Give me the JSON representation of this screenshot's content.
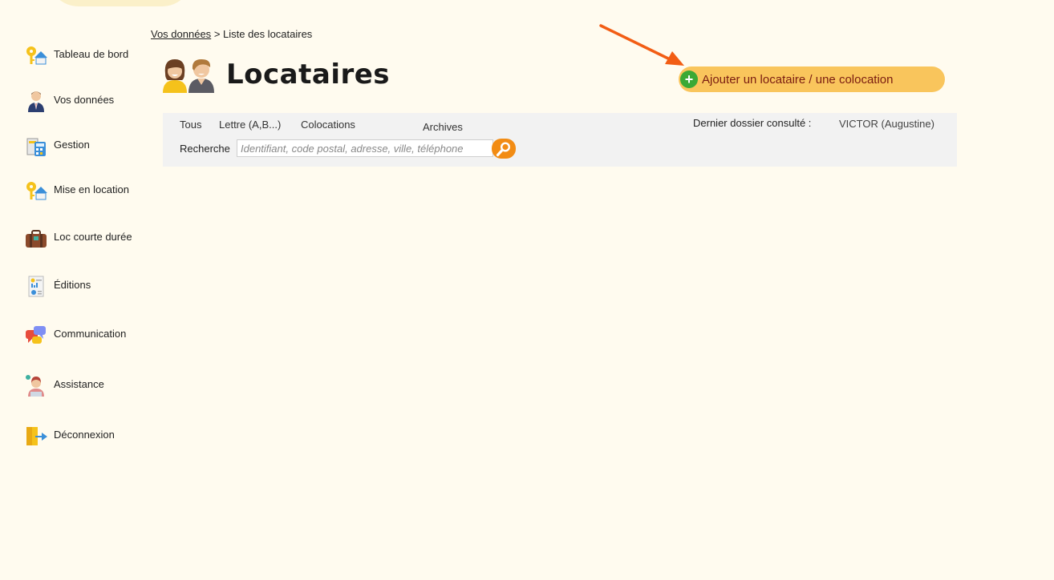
{
  "sidebar": {
    "items": [
      {
        "label": "Tableau de bord",
        "icon": "keys-house-icon"
      },
      {
        "label": "Vos données",
        "icon": "businessman-icon"
      },
      {
        "label": "Gestion",
        "icon": "calculator-icon"
      },
      {
        "label": "Mise en location",
        "icon": "keys-house-icon"
      },
      {
        "label": "Loc courte durée",
        "icon": "suitcase-icon"
      },
      {
        "label": "Éditions",
        "icon": "report-icon"
      },
      {
        "label": "Communication",
        "icon": "chat-bubbles-icon"
      },
      {
        "label": "Assistance",
        "icon": "support-agent-icon"
      },
      {
        "label": "Déconnexion",
        "icon": "logout-door-icon"
      }
    ]
  },
  "breadcrumb": {
    "parent": "Vos données",
    "separator": ">",
    "current": "Liste des locataires"
  },
  "page": {
    "title": "Locataires",
    "title_icon": "tenants-couple-icon"
  },
  "actions": {
    "add_label": "Ajouter un locataire / une colocation",
    "add_icon": "plus-icon"
  },
  "filters": {
    "tabs": [
      "Tous",
      "Lettre (A,B...)",
      "Colocations",
      "Archives"
    ],
    "last_viewed_label": "Dernier dossier consulté :",
    "last_viewed_value": "VICTOR (Augustine)",
    "search_label": "Recherche",
    "search_placeholder": "Identifiant, code postal, adresse, ville, téléphone",
    "search_icon": "magnifier-icon"
  },
  "colors": {
    "background": "#fffbef",
    "accent_button": "#f9c55c",
    "button_text": "#7a1c10",
    "plus": "#3aa935",
    "search_button": "#f28c14",
    "arrow": "#f25d14",
    "panel": "#f2f2f2"
  }
}
